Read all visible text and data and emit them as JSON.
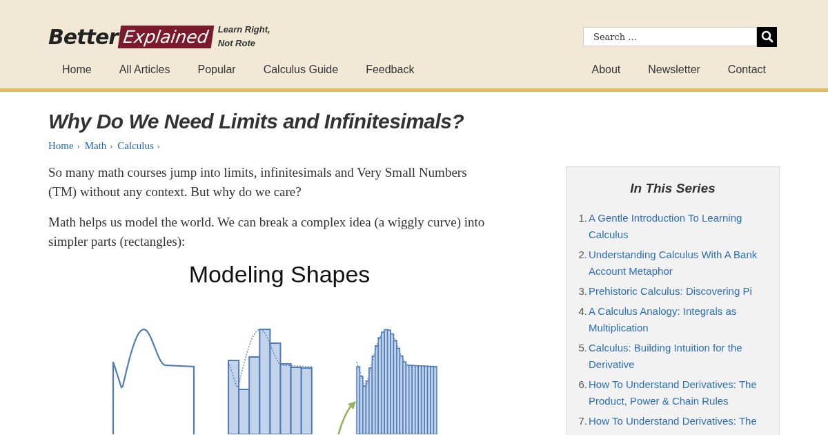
{
  "logo": {
    "word_1": "Better",
    "word_2": "Explained",
    "tagline_1": "Learn Right,",
    "tagline_2": "Not Rote"
  },
  "search": {
    "placeholder": "Search ..."
  },
  "nav_left": [
    "Home",
    "All Articles",
    "Popular",
    "Calculus Guide",
    "Feedback"
  ],
  "nav_right": [
    "About",
    "Newsletter",
    "Contact"
  ],
  "article": {
    "title": "Why Do We Need Limits and Infinitesimals?",
    "breadcrumbs": [
      "Home",
      "Math",
      "Calculus"
    ],
    "separator": "›",
    "paragraphs": [
      "So many math courses jump into limits, infinitesimals and Very Small Numbers (TM) without any context. But why do we care?",
      "Math helps us model the world. We can break a complex idea (a wiggly curve) into simpler parts (rectangles):"
    ],
    "figure_title": "Modeling Shapes"
  },
  "sidebar": {
    "title": "In This Series",
    "items": [
      {
        "number": "1.",
        "text": "A Gentle Introduction To Learning Calculus"
      },
      {
        "number": "2.",
        "text": "Understanding Calculus With A Bank Account Metaphor"
      },
      {
        "number": "3.",
        "text": "Prehistoric Calculus: Discovering Pi"
      },
      {
        "number": "4.",
        "text": "A Calculus Analogy: Integrals as Multiplication"
      },
      {
        "number": "5.",
        "text": "Calculus: Building Intuition for the Derivative"
      },
      {
        "number": "6.",
        "text": "How To Understand Derivatives: The Product, Power & Chain Rules"
      },
      {
        "number": "7.",
        "text": "How To Understand Derivatives: The"
      }
    ]
  }
}
